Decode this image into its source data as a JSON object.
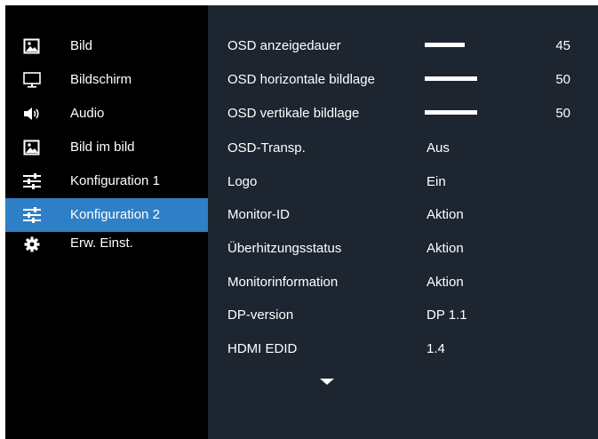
{
  "colors": {
    "accent": "#2f7fc6",
    "panel": "#1c2530",
    "background": "#000000"
  },
  "sidebar": {
    "items": [
      {
        "label": "Bild",
        "icon": "picture-icon",
        "active": false
      },
      {
        "label": "Bildschirm",
        "icon": "monitor-icon",
        "active": false
      },
      {
        "label": "Audio",
        "icon": "speaker-icon",
        "active": false
      },
      {
        "label": "Bild im bild",
        "icon": "picture-in-picture-icon",
        "active": false
      },
      {
        "label": "Konfiguration 1",
        "icon": "sliders-icon",
        "active": false
      },
      {
        "label": "Konfiguration 2",
        "icon": "sliders-icon",
        "active": true
      },
      {
        "label": "Erw. Einst.",
        "icon": "gear-icon",
        "active": false
      }
    ]
  },
  "settings": {
    "rows": [
      {
        "label": "OSD anzeigedauer",
        "slider_value": 45,
        "slider_fraction": 0.5
      },
      {
        "label": "OSD horizontale bildlage",
        "slider_value": 50,
        "slider_fraction": 0.65
      },
      {
        "label": "OSD vertikale bildlage",
        "slider_value": 50,
        "slider_fraction": 0.65
      },
      {
        "label": "OSD-Transp.",
        "value": "Aus"
      },
      {
        "label": "Logo",
        "value": "Ein"
      },
      {
        "label": "Monitor-ID",
        "value": "Aktion"
      },
      {
        "label": "Überhitzungsstatus",
        "value": "Aktion"
      },
      {
        "label": "Monitorinformation",
        "value": "Aktion"
      },
      {
        "label": "DP-version",
        "value": "DP 1.1"
      },
      {
        "label": "HDMI EDID",
        "value": "1.4"
      }
    ],
    "more_indicator": "chevron-down-icon"
  }
}
